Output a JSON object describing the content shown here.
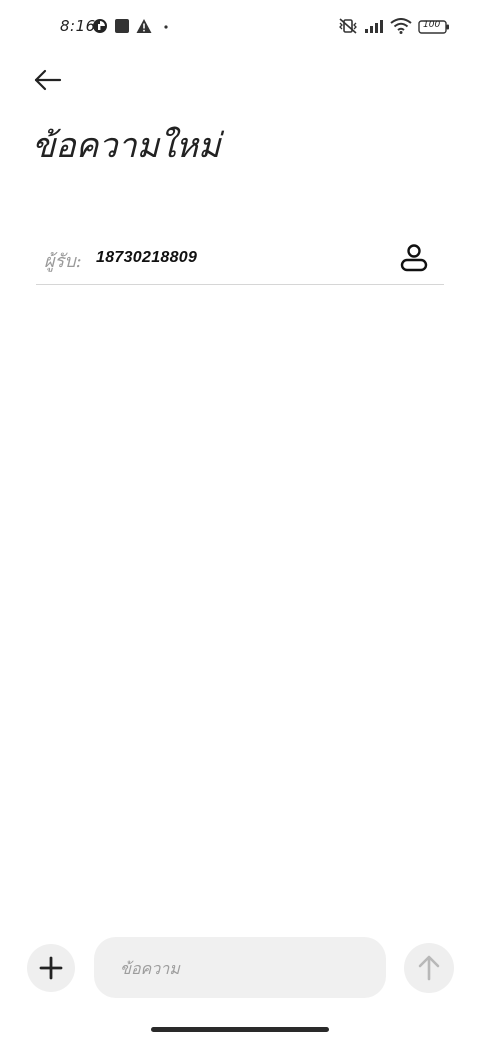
{
  "status_bar": {
    "time": "8:16",
    "battery": "100",
    "icons": [
      "data-saver-icon",
      "square-notification-icon",
      "warning-icon",
      "dot-icon",
      "vibrate-off-icon",
      "signal-icon",
      "wifi-icon",
      "battery-icon"
    ]
  },
  "header": {
    "back_icon": "back-arrow-icon",
    "title": "ข้อความใหม่"
  },
  "recipient": {
    "label": "ผู้รับ:",
    "value": "18730218809",
    "contact_icon": "person-icon"
  },
  "composer": {
    "add_icon": "plus-icon",
    "message_placeholder": "ข้อความ",
    "send_icon": "arrow-up-icon"
  }
}
